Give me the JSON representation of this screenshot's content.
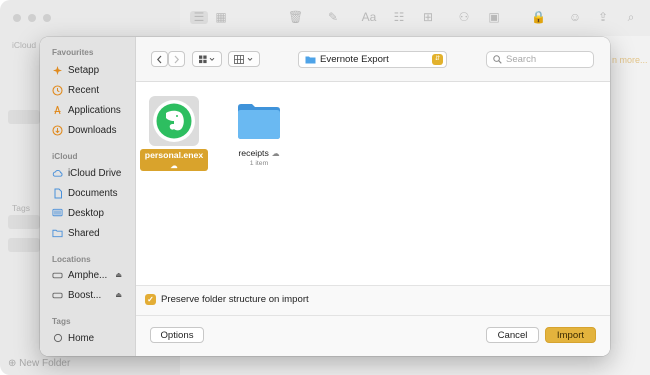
{
  "background": {
    "sidebar_labels": [
      "iCloud",
      "Tags"
    ],
    "new_folder_label": "New Folder",
    "learn_more": "n more..."
  },
  "dialog": {
    "sidebar": {
      "sections": [
        {
          "label": "Favourites",
          "items": [
            {
              "label": "Setapp",
              "icon": "setapp-icon"
            },
            {
              "label": "Recent",
              "icon": "clock-icon"
            },
            {
              "label": "Applications",
              "icon": "applications-icon"
            },
            {
              "label": "Downloads",
              "icon": "download-icon"
            }
          ]
        },
        {
          "label": "iCloud",
          "items": [
            {
              "label": "iCloud Drive",
              "icon": "cloud-icon"
            },
            {
              "label": "Documents",
              "icon": "document-icon"
            },
            {
              "label": "Desktop",
              "icon": "desktop-icon"
            },
            {
              "label": "Shared",
              "icon": "shared-folder-icon"
            }
          ]
        },
        {
          "label": "Locations",
          "items": [
            {
              "label": "Amphe...",
              "icon": "drive-icon"
            },
            {
              "label": "Boost...",
              "icon": "drive-icon"
            }
          ]
        },
        {
          "label": "Tags",
          "items": [
            {
              "label": "Home",
              "icon": "tag-circle-icon"
            }
          ]
        }
      ]
    },
    "toolbar": {
      "path_label": "Evernote Export",
      "search_placeholder": "Search"
    },
    "files": [
      {
        "name": "personal.enex",
        "selected": true
      },
      {
        "name": "receipts",
        "subtitle": "1 item",
        "selected": false
      }
    ],
    "options": {
      "preserve_label": "Preserve folder structure on import",
      "preserve_checked": true
    },
    "buttons": {
      "options": "Options",
      "cancel": "Cancel",
      "import": "Import"
    },
    "colors": {
      "accent": "#e3b33d",
      "folder": "#4ea3e8",
      "evernote": "#2dbe60"
    }
  }
}
